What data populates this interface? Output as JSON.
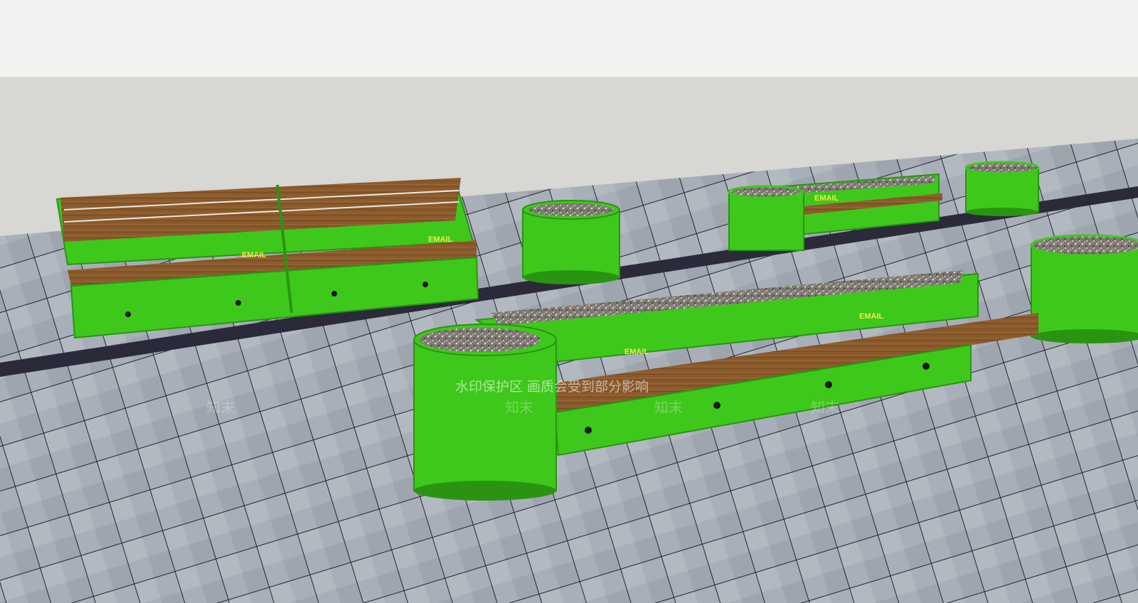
{
  "scene": {
    "colors": {
      "sky": "#f2f2f1",
      "wall": "#d7d7d4",
      "paving": "#a4abb4",
      "paving_joint": "#1f2530",
      "drain_strip": "#2b2a3a",
      "steel_green": "#3fc81c",
      "steel_green_dark": "#2a9412",
      "wood": "#8a5a2c",
      "gravel": "#7d7872"
    },
    "labels": {
      "bench_left_a": "EMAIL",
      "bench_left_b": "EMAIL",
      "bench_back": "EMAIL",
      "main_planter_a": "EMAIL",
      "main_planter_b": "EMAIL"
    },
    "watermark": {
      "text": "水印保护区  画质会受到部分影响",
      "repeat": "知末"
    }
  }
}
